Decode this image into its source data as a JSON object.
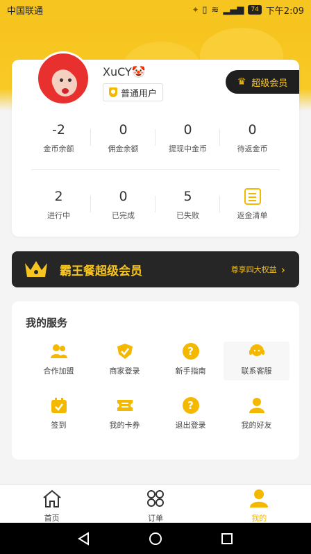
{
  "status_bar": {
    "carrier": "中国联通",
    "battery": "74",
    "time": "下午2:09"
  },
  "profile": {
    "username": "XuCY🤡",
    "user_type": "普通用户",
    "vip_button": "超级会员"
  },
  "stats_top": [
    {
      "value": "-2",
      "label": "金币余额"
    },
    {
      "value": "0",
      "label": "佣金余额"
    },
    {
      "value": "0",
      "label": "提现中金币"
    },
    {
      "value": "0",
      "label": "待返金币"
    }
  ],
  "stats_bottom": [
    {
      "value": "2",
      "label": "进行中"
    },
    {
      "value": "0",
      "label": "已完成"
    },
    {
      "value": "5",
      "label": "已失败"
    },
    {
      "value": "",
      "label": "返金清单"
    }
  ],
  "vip_banner": {
    "title": "霸王餐超级会员",
    "more": "尊享四大权益"
  },
  "services": {
    "title": "我的服务",
    "items": [
      {
        "label": "合作加盟",
        "icon": "users-icon"
      },
      {
        "label": "商家登录",
        "icon": "shield-check-icon"
      },
      {
        "label": "新手指南",
        "icon": "question-icon"
      },
      {
        "label": "联系客服",
        "icon": "headset-icon"
      },
      {
        "label": "签到",
        "icon": "calendar-check-icon"
      },
      {
        "label": "我的卡券",
        "icon": "ticket-icon"
      },
      {
        "label": "退出登录",
        "icon": "question-icon"
      },
      {
        "label": "我的好友",
        "icon": "user-icon"
      }
    ]
  },
  "tabs": [
    {
      "label": "首页",
      "icon": "home-icon"
    },
    {
      "label": "订单",
      "icon": "grid-icon"
    },
    {
      "label": "我的",
      "icon": "user-icon"
    }
  ],
  "colors": {
    "accent": "#f5b800",
    "header": "#f7c51f",
    "dark": "#262626"
  }
}
